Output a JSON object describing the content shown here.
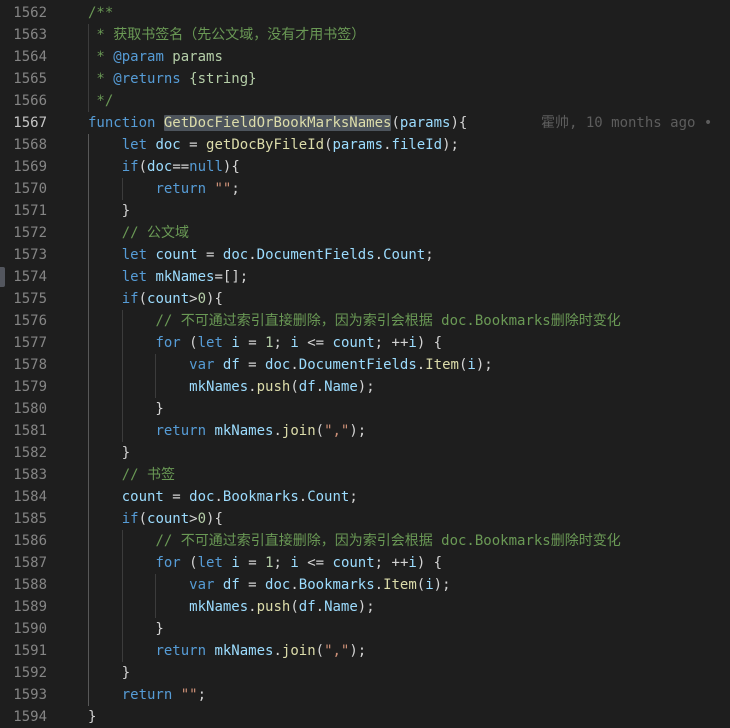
{
  "editor": {
    "first_line_number": 1562,
    "active_line_number": 1567,
    "gutter_marker_line": 1574,
    "blame": {
      "line": 1567,
      "text": "霍帅, 10 months ago •"
    },
    "colors": {
      "background": "#1e1e1e",
      "kw": "#569CD6",
      "var": "#9CDCFE",
      "fn": "#DCDCAA",
      "str": "#CE9178",
      "num": "#B5CEA8",
      "cmt": "#6A9955",
      "doc": "#B5CEA8",
      "pun": "#D4D4D4",
      "blame": "#5d5d5d",
      "line_number": "#858585",
      "line_number_active": "#c6c6c6",
      "indent_guide": "#3c3c3c",
      "indent_guide_active": "#585858",
      "word_highlight": "#4d545c"
    },
    "lines": [
      {
        "num": 1562,
        "tokens": [
          [
            "cmt",
            "/**"
          ]
        ]
      },
      {
        "num": 1563,
        "tokens": [
          [
            "cmt",
            " * 获取书签名（先公文域，没有才用书签）"
          ]
        ]
      },
      {
        "num": 1564,
        "tokens": [
          [
            "cmt",
            " * "
          ],
          [
            "kw",
            "@param"
          ],
          [
            "doc",
            " params"
          ]
        ]
      },
      {
        "num": 1565,
        "tokens": [
          [
            "cmt",
            " * "
          ],
          [
            "kw",
            "@returns"
          ],
          [
            "doc",
            " {string}"
          ]
        ]
      },
      {
        "num": 1566,
        "tokens": [
          [
            "cmt",
            " */"
          ]
        ]
      },
      {
        "num": 1567,
        "tokens": [
          [
            "kw",
            "function"
          ],
          [
            "pun",
            " "
          ],
          [
            "fn",
            "GetDocFieldOrBookMarksNames",
            "hl"
          ],
          [
            "pun",
            "("
          ],
          [
            "var",
            "params"
          ],
          [
            "pun",
            "){"
          ]
        ]
      },
      {
        "num": 1568,
        "tokens": [
          [
            "pun",
            "    "
          ],
          [
            "kw",
            "let"
          ],
          [
            "pun",
            " "
          ],
          [
            "var",
            "doc"
          ],
          [
            "pun",
            " = "
          ],
          [
            "fn",
            "getDocByFileId"
          ],
          [
            "pun",
            "("
          ],
          [
            "var",
            "params"
          ],
          [
            "pun",
            "."
          ],
          [
            "var",
            "fileId"
          ],
          [
            "pun",
            ");"
          ]
        ]
      },
      {
        "num": 1569,
        "tokens": [
          [
            "pun",
            "    "
          ],
          [
            "kw",
            "if"
          ],
          [
            "pun",
            "("
          ],
          [
            "var",
            "doc"
          ],
          [
            "pun",
            "=="
          ],
          [
            "kw",
            "null"
          ],
          [
            "pun",
            "){"
          ]
        ]
      },
      {
        "num": 1570,
        "tokens": [
          [
            "pun",
            "        "
          ],
          [
            "kw",
            "return"
          ],
          [
            "pun",
            " "
          ],
          [
            "str",
            "\"\""
          ],
          [
            "pun",
            ";"
          ]
        ]
      },
      {
        "num": 1571,
        "tokens": [
          [
            "pun",
            "    }"
          ]
        ]
      },
      {
        "num": 1572,
        "tokens": [
          [
            "pun",
            "    "
          ],
          [
            "cmt",
            "// 公文域"
          ]
        ]
      },
      {
        "num": 1573,
        "tokens": [
          [
            "pun",
            "    "
          ],
          [
            "kw",
            "let"
          ],
          [
            "pun",
            " "
          ],
          [
            "var",
            "count"
          ],
          [
            "pun",
            " = "
          ],
          [
            "var",
            "doc"
          ],
          [
            "pun",
            "."
          ],
          [
            "var",
            "DocumentFields"
          ],
          [
            "pun",
            "."
          ],
          [
            "var",
            "Count"
          ],
          [
            "pun",
            ";"
          ]
        ]
      },
      {
        "num": 1574,
        "tokens": [
          [
            "pun",
            "    "
          ],
          [
            "kw",
            "let"
          ],
          [
            "pun",
            " "
          ],
          [
            "var",
            "mkNames"
          ],
          [
            "pun",
            "=[];"
          ]
        ]
      },
      {
        "num": 1575,
        "tokens": [
          [
            "pun",
            "    "
          ],
          [
            "kw",
            "if"
          ],
          [
            "pun",
            "("
          ],
          [
            "var",
            "count"
          ],
          [
            "pun",
            ">"
          ],
          [
            "num",
            "0"
          ],
          [
            "pun",
            "){"
          ]
        ]
      },
      {
        "num": 1576,
        "tokens": [
          [
            "pun",
            "        "
          ],
          [
            "cmt",
            "// 不可通过索引直接删除，因为索引会根据 doc.Bookmarks删除时变化"
          ]
        ]
      },
      {
        "num": 1577,
        "tokens": [
          [
            "pun",
            "        "
          ],
          [
            "kw",
            "for"
          ],
          [
            "pun",
            " ("
          ],
          [
            "kw",
            "let"
          ],
          [
            "pun",
            " "
          ],
          [
            "var",
            "i"
          ],
          [
            "pun",
            " = "
          ],
          [
            "num",
            "1"
          ],
          [
            "pun",
            "; "
          ],
          [
            "var",
            "i"
          ],
          [
            "pun",
            " <= "
          ],
          [
            "var",
            "count"
          ],
          [
            "pun",
            "; ++"
          ],
          [
            "var",
            "i"
          ],
          [
            "pun",
            ") {"
          ]
        ]
      },
      {
        "num": 1578,
        "tokens": [
          [
            "pun",
            "            "
          ],
          [
            "kw",
            "var"
          ],
          [
            "pun",
            " "
          ],
          [
            "var",
            "df"
          ],
          [
            "pun",
            " = "
          ],
          [
            "var",
            "doc"
          ],
          [
            "pun",
            "."
          ],
          [
            "var",
            "DocumentFields"
          ],
          [
            "pun",
            "."
          ],
          [
            "fn",
            "Item"
          ],
          [
            "pun",
            "("
          ],
          [
            "var",
            "i"
          ],
          [
            "pun",
            ");"
          ]
        ]
      },
      {
        "num": 1579,
        "tokens": [
          [
            "pun",
            "            "
          ],
          [
            "var",
            "mkNames"
          ],
          [
            "pun",
            "."
          ],
          [
            "fn",
            "push"
          ],
          [
            "pun",
            "("
          ],
          [
            "var",
            "df"
          ],
          [
            "pun",
            "."
          ],
          [
            "var",
            "Name"
          ],
          [
            "pun",
            ");"
          ]
        ]
      },
      {
        "num": 1580,
        "tokens": [
          [
            "pun",
            "        }"
          ]
        ]
      },
      {
        "num": 1581,
        "tokens": [
          [
            "pun",
            "        "
          ],
          [
            "kw",
            "return"
          ],
          [
            "pun",
            " "
          ],
          [
            "var",
            "mkNames"
          ],
          [
            "pun",
            "."
          ],
          [
            "fn",
            "join"
          ],
          [
            "pun",
            "("
          ],
          [
            "str",
            "\",\""
          ],
          [
            "pun",
            ");"
          ]
        ]
      },
      {
        "num": 1582,
        "tokens": [
          [
            "pun",
            "    }"
          ]
        ]
      },
      {
        "num": 1583,
        "tokens": [
          [
            "pun",
            "    "
          ],
          [
            "cmt",
            "// 书签"
          ]
        ]
      },
      {
        "num": 1584,
        "tokens": [
          [
            "pun",
            "    "
          ],
          [
            "var",
            "count"
          ],
          [
            "pun",
            " = "
          ],
          [
            "var",
            "doc"
          ],
          [
            "pun",
            "."
          ],
          [
            "var",
            "Bookmarks"
          ],
          [
            "pun",
            "."
          ],
          [
            "var",
            "Count"
          ],
          [
            "pun",
            ";"
          ]
        ]
      },
      {
        "num": 1585,
        "tokens": [
          [
            "pun",
            "    "
          ],
          [
            "kw",
            "if"
          ],
          [
            "pun",
            "("
          ],
          [
            "var",
            "count"
          ],
          [
            "pun",
            ">"
          ],
          [
            "num",
            "0"
          ],
          [
            "pun",
            "){"
          ]
        ]
      },
      {
        "num": 1586,
        "tokens": [
          [
            "pun",
            "        "
          ],
          [
            "cmt",
            "// 不可通过索引直接删除，因为索引会根据 doc.Bookmarks删除时变化"
          ]
        ]
      },
      {
        "num": 1587,
        "tokens": [
          [
            "pun",
            "        "
          ],
          [
            "kw",
            "for"
          ],
          [
            "pun",
            " ("
          ],
          [
            "kw",
            "let"
          ],
          [
            "pun",
            " "
          ],
          [
            "var",
            "i"
          ],
          [
            "pun",
            " = "
          ],
          [
            "num",
            "1"
          ],
          [
            "pun",
            "; "
          ],
          [
            "var",
            "i"
          ],
          [
            "pun",
            " <= "
          ],
          [
            "var",
            "count"
          ],
          [
            "pun",
            "; ++"
          ],
          [
            "var",
            "i"
          ],
          [
            "pun",
            ") {"
          ]
        ]
      },
      {
        "num": 1588,
        "tokens": [
          [
            "pun",
            "            "
          ],
          [
            "kw",
            "var"
          ],
          [
            "pun",
            " "
          ],
          [
            "var",
            "df"
          ],
          [
            "pun",
            " = "
          ],
          [
            "var",
            "doc"
          ],
          [
            "pun",
            "."
          ],
          [
            "var",
            "Bookmarks"
          ],
          [
            "pun",
            "."
          ],
          [
            "fn",
            "Item"
          ],
          [
            "pun",
            "("
          ],
          [
            "var",
            "i"
          ],
          [
            "pun",
            ");"
          ]
        ]
      },
      {
        "num": 1589,
        "tokens": [
          [
            "pun",
            "            "
          ],
          [
            "var",
            "mkNames"
          ],
          [
            "pun",
            "."
          ],
          [
            "fn",
            "push"
          ],
          [
            "pun",
            "("
          ],
          [
            "var",
            "df"
          ],
          [
            "pun",
            "."
          ],
          [
            "var",
            "Name"
          ],
          [
            "pun",
            ");"
          ]
        ]
      },
      {
        "num": 1590,
        "tokens": [
          [
            "pun",
            "        }"
          ]
        ]
      },
      {
        "num": 1591,
        "tokens": [
          [
            "pun",
            "        "
          ],
          [
            "kw",
            "return"
          ],
          [
            "pun",
            " "
          ],
          [
            "var",
            "mkNames"
          ],
          [
            "pun",
            "."
          ],
          [
            "fn",
            "join"
          ],
          [
            "pun",
            "("
          ],
          [
            "str",
            "\",\""
          ],
          [
            "pun",
            ");"
          ]
        ]
      },
      {
        "num": 1592,
        "tokens": [
          [
            "pun",
            "    }"
          ]
        ]
      },
      {
        "num": 1593,
        "tokens": [
          [
            "pun",
            "    "
          ],
          [
            "kw",
            "return"
          ],
          [
            "pun",
            " "
          ],
          [
            "str",
            "\"\""
          ],
          [
            "pun",
            ";"
          ]
        ]
      },
      {
        "num": 1594,
        "tokens": [
          [
            "pun",
            "}"
          ]
        ]
      }
    ]
  }
}
